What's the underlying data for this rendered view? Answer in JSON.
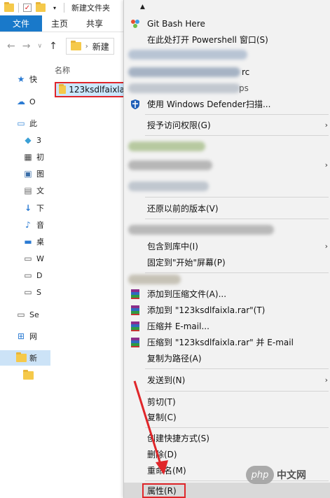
{
  "window": {
    "title": "新建文件夹"
  },
  "ribbon": {
    "tabs": [
      "文件",
      "主页",
      "共享"
    ]
  },
  "address": {
    "path": "新建"
  },
  "nav": {
    "items": [
      {
        "icon": "star-icon",
        "label": "快"
      },
      {
        "icon": "cloud-icon",
        "label": "O"
      },
      {
        "icon": "computer-icon",
        "label": "此"
      },
      {
        "icon": "cube-icon",
        "label": "3"
      },
      {
        "icon": "film-icon",
        "label": "初"
      },
      {
        "icon": "picture-icon",
        "label": "图"
      },
      {
        "icon": "document-icon",
        "label": "文"
      },
      {
        "icon": "download-icon",
        "label": "下"
      },
      {
        "icon": "music-icon",
        "label": "音"
      },
      {
        "icon": "desktop-icon",
        "label": "桌"
      },
      {
        "icon": "drive-icon",
        "label": "W"
      },
      {
        "icon": "drive-icon",
        "label": "D"
      },
      {
        "icon": "drive-icon",
        "label": "S"
      },
      {
        "icon": "drive-icon",
        "label": "Se"
      },
      {
        "icon": "network-icon",
        "label": "网"
      },
      {
        "icon": "folder-icon",
        "label": "新"
      },
      {
        "icon": "folder-icon",
        "label": ""
      }
    ]
  },
  "files": {
    "column_name": "名称",
    "rows": [
      {
        "name": "123ksdlfaixla"
      }
    ]
  },
  "context_menu": {
    "items": [
      {
        "label": "Git Bash Here",
        "icon": "git-icon"
      },
      {
        "label": "在此处打开 Powershell 窗口(S)",
        "icon": ""
      },
      {
        "label": "使用 Windows Defender扫描...",
        "icon": "shield-icon"
      },
      {
        "label": "授予访问权限(G)",
        "icon": "",
        "submenu": true
      },
      {
        "label": "还原以前的版本(V)",
        "icon": ""
      },
      {
        "label": "包含到库中(I)",
        "icon": "",
        "submenu": true
      },
      {
        "label": "固定到\"开始\"屏幕(P)",
        "icon": ""
      },
      {
        "label": "添加到压缩文件(A)...",
        "icon": "winrar-icon"
      },
      {
        "label": "添加到 \"123ksdlfaixla.rar\"(T)",
        "icon": "winrar-icon"
      },
      {
        "label": "压缩并 E-mail...",
        "icon": "winrar-icon"
      },
      {
        "label": "压缩到 \"123ksdlfaixla.rar\" 并 E-mail",
        "icon": "winrar-icon"
      },
      {
        "label": "复制为路径(A)",
        "icon": ""
      },
      {
        "label": "发送到(N)",
        "icon": "",
        "submenu": true
      },
      {
        "label": "剪切(T)",
        "icon": ""
      },
      {
        "label": "复制(C)",
        "icon": ""
      },
      {
        "label": "创建快捷方式(S)",
        "icon": ""
      },
      {
        "label": "删除(D)",
        "icon": ""
      },
      {
        "label": "重命名(M)",
        "icon": ""
      },
      {
        "label": "属性(R)",
        "icon": ""
      }
    ],
    "obscured_fragments": [
      "rc",
      "ps"
    ]
  },
  "watermark": {
    "logo_text": "php",
    "text": "中文网"
  },
  "colors": {
    "accent": "#1979ca",
    "highlight_red": "#e0262a",
    "selection": "#cce8ff"
  }
}
